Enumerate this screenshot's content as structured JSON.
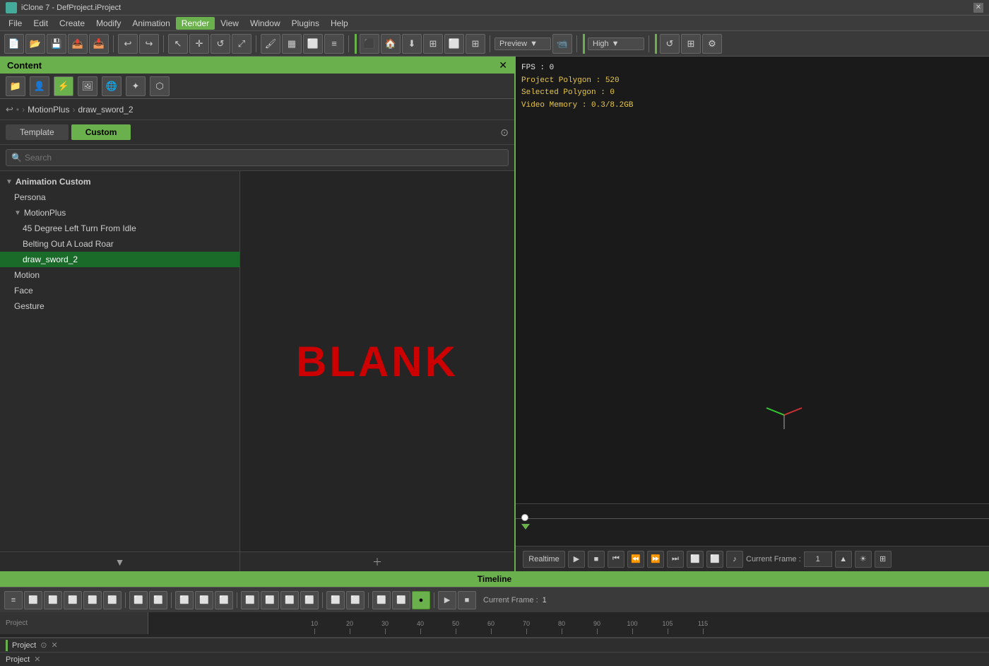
{
  "titleBar": {
    "icon": "iclone-icon",
    "title": "iClone 7 - DefProject.iProject",
    "closeBtn": "✕"
  },
  "menuBar": {
    "items": [
      "File",
      "Edit",
      "Create",
      "Modify",
      "Animation",
      "Render",
      "View",
      "Window",
      "Plugins",
      "Help"
    ],
    "activeItem": "Render"
  },
  "toolbar": {
    "previewLabel": "Preview",
    "qualityLabel": "High"
  },
  "contentPanel": {
    "title": "Content",
    "closeBtn": "✕",
    "tabs": {
      "template": "Template",
      "custom": "Custom"
    },
    "search": {
      "placeholder": "Search"
    },
    "breadcrumb": {
      "motionplus": "MotionPlus",
      "drawSword": "draw_sword_2"
    },
    "tree": [
      {
        "label": "Animation Custom",
        "level": 0,
        "expanded": true,
        "id": "anim-custom"
      },
      {
        "label": "Persona",
        "level": 1,
        "id": "persona"
      },
      {
        "label": "MotionPlus",
        "level": 1,
        "expanded": true,
        "id": "motionplus"
      },
      {
        "label": "45 Degree Left Turn From Idle",
        "level": 2,
        "id": "45deg"
      },
      {
        "label": "Belting Out A Load Roar",
        "level": 2,
        "id": "belting"
      },
      {
        "label": "draw_sword_2",
        "level": 2,
        "selected": true,
        "id": "draw-sword"
      },
      {
        "label": "Motion",
        "level": 1,
        "id": "motion"
      },
      {
        "label": "Face",
        "level": 1,
        "id": "face"
      },
      {
        "label": "Gesture",
        "level": 1,
        "id": "gesture"
      }
    ],
    "preview": {
      "blankText": "BLANK"
    }
  },
  "viewport": {
    "stats": {
      "fps": "FPS : 0",
      "polygon": "Project Polygon : 520",
      "selected": "Selected Polygon : 0",
      "vmem": "Video Memory : 0.3/8.2GB"
    }
  },
  "playback": {
    "realtimeBtn": "Realtime",
    "playBtn": "▶",
    "stopBtn": "■",
    "beginBtn": "⏮",
    "prevBtn": "⏪",
    "nextBtn": "⏩",
    "endBtn": "⏭",
    "frameLabel": "Current Frame :",
    "frameValue": "1"
  },
  "timeline": {
    "title": "Timeline",
    "rulerMarks": [
      "10",
      "20",
      "30",
      "40",
      "50",
      "60",
      "70",
      "80",
      "90",
      "100",
      "105",
      "115"
    ]
  },
  "bottomToolbar": {
    "currentFrameLabel": "Current Frame :",
    "currentFrameValue": "1"
  },
  "projectRow": {
    "label": "Project",
    "closeBtn": "✕"
  }
}
